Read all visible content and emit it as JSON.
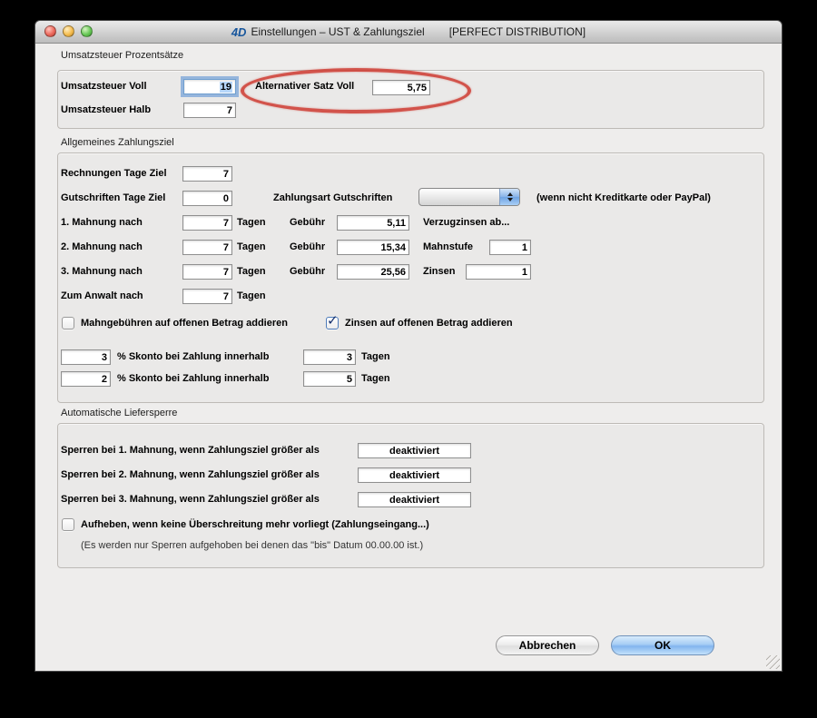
{
  "window": {
    "logo": "4D",
    "title": "Einstellungen – UST & Zahlungsziel",
    "suffix": "[PERFECT DISTRIBUTION]"
  },
  "colors": {
    "annotation_red": "#ce3e34",
    "focus_ring_blue": "#7fa8d8",
    "selection_blue": "#b6d6f9",
    "default_button_blue": "#82b4ee"
  },
  "icons": {
    "checkmark": "✓"
  },
  "vat": {
    "title": "Umsatzsteuer Prozentsätze",
    "voll_label": "Umsatzsteuer Voll",
    "voll_value": "19",
    "alt_label": "Alternativer Satz Voll",
    "alt_value": "5,75",
    "halb_label": "Umsatzsteuer Halb",
    "halb_value": "7"
  },
  "payment": {
    "title": "Allgemeines Zahlungsziel",
    "invoice_label": "Rechnungen Tage Ziel",
    "invoice_value": "7",
    "credit_label": "Gutschriften Tage Ziel",
    "credit_value": "0",
    "credit_type_label": "Zahlungsart Gutschriften",
    "credit_type_value": "",
    "credit_type_note": "(wenn nicht Kreditkarte oder PayPal)",
    "reminders": [
      {
        "label": "1. Mahnung nach",
        "days": "7",
        "days_unit": "Tagen",
        "fee_label": "Gebühr",
        "fee": "5,11",
        "extra_label": "Verzugzinsen ab..."
      },
      {
        "label": "2. Mahnung nach",
        "days": "7",
        "days_unit": "Tagen",
        "fee_label": "Gebühr",
        "fee": "15,34",
        "extra_label": "Mahnstufe",
        "extra_value": "1"
      },
      {
        "label": "3. Mahnung nach",
        "days": "7",
        "days_unit": "Tagen",
        "fee_label": "Gebühr",
        "fee": "25,56",
        "extra_label": "Zinsen",
        "extra_value": "1"
      }
    ],
    "lawyer_label": "Zum Anwalt nach",
    "lawyer_value": "7",
    "lawyer_unit": "Tagen",
    "checkbox_fees_label": "Mahngebühren auf offenen Betrag addieren",
    "checkbox_interest_label": "Zinsen auf offenen Betrag addieren",
    "skonto": [
      {
        "percent": "3",
        "label": "% Skonto bei Zahlung innerhalb",
        "days": "3",
        "unit": "Tagen"
      },
      {
        "percent": "2",
        "label": "% Skonto bei Zahlung innerhalb",
        "days": "5",
        "unit": "Tagen"
      }
    ]
  },
  "block": {
    "title": "Automatische Liefersperre",
    "rows": [
      {
        "label": "Sperren bei 1. Mahnung, wenn Zahlungsziel größer als",
        "value": "deaktiviert"
      },
      {
        "label": "Sperren bei 2. Mahnung, wenn Zahlungsziel größer als",
        "value": "deaktiviert"
      },
      {
        "label": "Sperren bei 3. Mahnung, wenn Zahlungsziel größer als",
        "value": "deaktiviert"
      }
    ],
    "checkbox_label": "Aufheben, wenn keine Überschreitung mehr vorliegt (Zahlungseingang...)",
    "note": "(Es werden nur Sperren aufgehoben bei denen das \"bis\" Datum 00.00.00 ist.)"
  },
  "buttons": {
    "cancel": "Abbrechen",
    "ok": "OK"
  }
}
